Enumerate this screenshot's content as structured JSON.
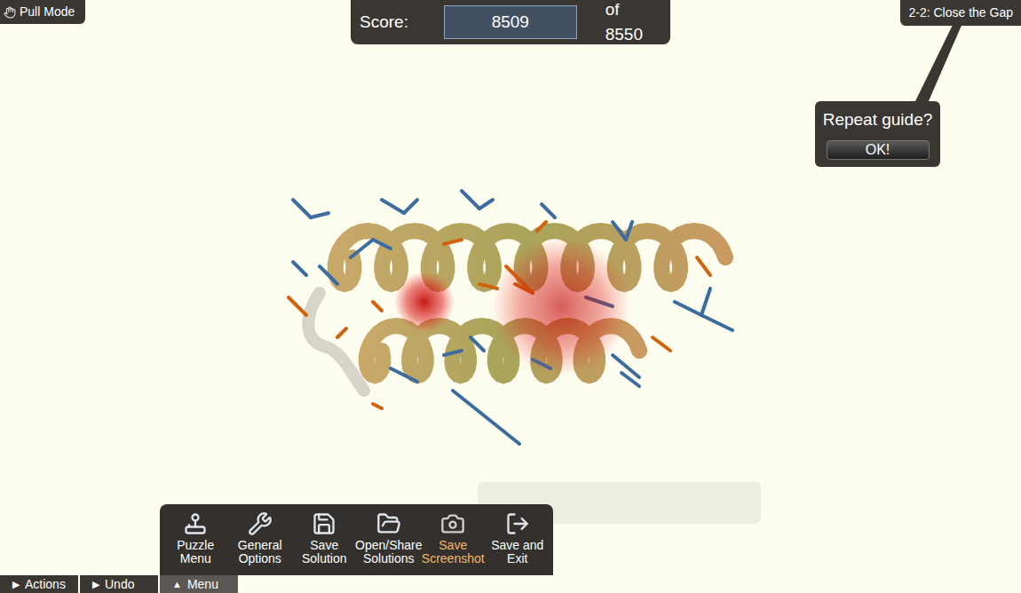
{
  "mode": {
    "label": "Pull Mode"
  },
  "score": {
    "label": "Score:",
    "value": "8509",
    "max": "of 8550"
  },
  "level": {
    "title": "2-2: Close the Gap"
  },
  "guide": {
    "question": "Repeat guide?",
    "button": "OK!"
  },
  "menu": [
    {
      "lines": [
        "Puzzle",
        "Menu"
      ],
      "highlighted": false
    },
    {
      "lines": [
        "General",
        "Options"
      ],
      "highlighted": false
    },
    {
      "lines": [
        "Save",
        "Solution"
      ],
      "highlighted": false
    },
    {
      "lines": [
        "Open/Share",
        "Solutions"
      ],
      "highlighted": false
    },
    {
      "lines": [
        "Save",
        "Screenshot"
      ],
      "highlighted": true
    },
    {
      "lines": [
        "Save and",
        "Exit"
      ],
      "highlighted": false
    }
  ],
  "bottom_bar": [
    {
      "arrow": "▶",
      "label": "Actions",
      "selected": false
    },
    {
      "arrow": "▶",
      "label": "Undo",
      "selected": false
    },
    {
      "arrow": "▲",
      "label": "Menu",
      "selected": true
    }
  ]
}
